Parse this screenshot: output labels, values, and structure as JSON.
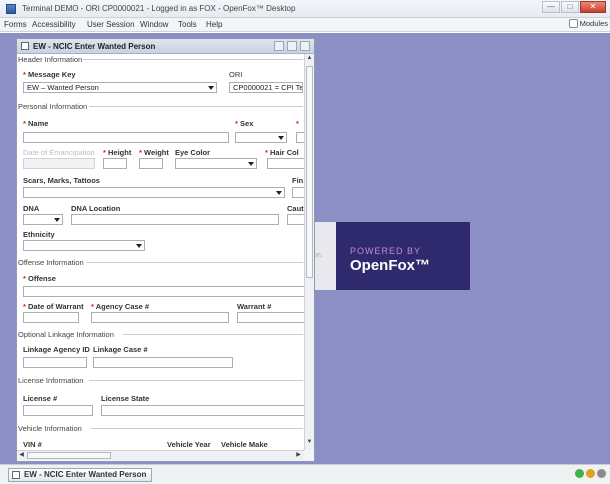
{
  "app": {
    "title": "Terminal DEMO - ORI CP0000021 - Logged in as FOX - OpenFox™ Desktop",
    "window_buttons": {
      "minimize": "—",
      "maximize": "□",
      "close": "✕"
    }
  },
  "menubar": {
    "items": [
      "Forms",
      "Accessibility",
      "User Session",
      "Window",
      "Tools",
      "Help"
    ],
    "modules_label": "Modules"
  },
  "splash": {
    "powered_by": "POWERED BY",
    "brand": "OpenFox™",
    "side_text": "on."
  },
  "form_window": {
    "title": "EW - NCIC Enter Wanted Person",
    "sections": {
      "header": "Header Information",
      "personal": "Personal Information",
      "offense": "Offense Information",
      "linkage": "Optional Linkage Information",
      "license": "License Information",
      "vehicle": "Vehicle Information"
    },
    "fields": {
      "message_key": {
        "label": "Message Key",
        "value": "EW – Wanted Person"
      },
      "ori": {
        "label": "ORI",
        "value": "CP0000021 = CPI Te"
      },
      "name": {
        "label": "Name"
      },
      "sex": {
        "label": "Sex"
      },
      "date_of_emancipation": {
        "label": "Date of Emancipation"
      },
      "height": {
        "label": "Height"
      },
      "weight": {
        "label": "Weight"
      },
      "eye_color": {
        "label": "Eye Color"
      },
      "hair_color": {
        "label": "Hair Col"
      },
      "smt": {
        "label": "Scars, Marks, Tattoos"
      },
      "fin": {
        "label": "Fin"
      },
      "dna": {
        "label": "DNA"
      },
      "dna_location": {
        "label": "DNA Location"
      },
      "caution": {
        "label": "Caut"
      },
      "ethnicity": {
        "label": "Ethnicity"
      },
      "offense": {
        "label": "Offense"
      },
      "date_of_warrant": {
        "label": "Date of Warrant"
      },
      "agency_case": {
        "label": "Agency Case #"
      },
      "warrant": {
        "label": "Warrant #"
      },
      "linkage_agency_id": {
        "label": "Linkage Agency ID"
      },
      "linkage_case": {
        "label": "Linkage Case #"
      },
      "license_num": {
        "label": "License #"
      },
      "license_state": {
        "label": "License State"
      },
      "vin": {
        "label": "VIN #"
      },
      "vehicle_year": {
        "label": "Vehicle Year"
      },
      "vehicle_make": {
        "label": "Vehicle Make"
      }
    },
    "required_marker": "*"
  },
  "taskbar": {
    "task_label": "EW - NCIC Enter Wanted Person"
  },
  "colors": {
    "desktop": "#8c8fc4",
    "splash_bg": "#2f2a6e",
    "required": "#d02020"
  }
}
